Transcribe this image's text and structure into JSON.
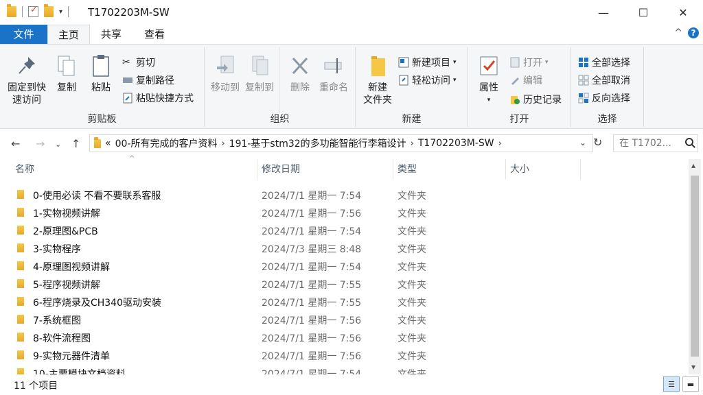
{
  "window": {
    "title": "T1702203M-SW",
    "minimize_glyph": "—",
    "maximize_glyph": "☐",
    "close_glyph": "✕"
  },
  "tabs": {
    "file": "文件",
    "home": "主页",
    "share": "共享",
    "view": "查看"
  },
  "ribbon": {
    "clipboard": {
      "label": "剪贴板",
      "pin": "固定到快速访问",
      "pin_line1": "固定到快",
      "pin_line2": "速访问",
      "copy": "复制",
      "paste": "粘贴",
      "cut": "剪切",
      "copy_path": "复制路径",
      "paste_shortcut": "粘贴快捷方式"
    },
    "organize": {
      "label": "组织",
      "move_to": "移动到",
      "copy_to": "复制到",
      "delete": "删除",
      "rename": "重命名"
    },
    "new": {
      "label": "新建",
      "new_folder_line1": "新建",
      "new_folder_line2": "文件夹",
      "new_item": "新建项目",
      "easy_access": "轻松访问"
    },
    "open": {
      "label": "打开",
      "properties": "属性",
      "open": "打开",
      "edit": "编辑",
      "history": "历史记录"
    },
    "select": {
      "label": "选择",
      "select_all": "全部选择",
      "select_none": "全部取消",
      "invert": "反向选择"
    }
  },
  "address": {
    "prefix": "«",
    "crumbs": [
      "00-所有完成的客户资料",
      "191-基于stm32的多功能智能行李箱设计",
      "T1702203M-SW"
    ],
    "search_placeholder": "在 T1702..."
  },
  "columns": {
    "name": "名称",
    "date": "修改日期",
    "type": "类型",
    "size": "大小"
  },
  "files": [
    {
      "name": "0-使用必读  不看不要联系客服",
      "date": "2024/7/1 星期一 7:54",
      "type": "文件夹"
    },
    {
      "name": "1-实物视频讲解",
      "date": "2024/7/1 星期一 7:56",
      "type": "文件夹"
    },
    {
      "name": "2-原理图&PCB",
      "date": "2024/7/1 星期一 7:54",
      "type": "文件夹"
    },
    {
      "name": "3-实物程序",
      "date": "2024/7/3 星期三 8:48",
      "type": "文件夹"
    },
    {
      "name": "4-原理图视频讲解",
      "date": "2024/7/1 星期一 7:54",
      "type": "文件夹"
    },
    {
      "name": "5-程序视频讲解",
      "date": "2024/7/1 星期一 7:55",
      "type": "文件夹"
    },
    {
      "name": "6-程序烧录及CH340驱动安装",
      "date": "2024/7/1 星期一 7:55",
      "type": "文件夹"
    },
    {
      "name": "7-系统框图",
      "date": "2024/7/1 星期一 7:56",
      "type": "文件夹"
    },
    {
      "name": "8-软件流程图",
      "date": "2024/7/1 星期一 7:56",
      "type": "文件夹"
    },
    {
      "name": "9-实物元器件清单",
      "date": "2024/7/1 星期一 7:56",
      "type": "文件夹"
    },
    {
      "name": "10-主要模块文档资料",
      "date": "2024/7/1 星期一 7:54",
      "type": "文件夹"
    }
  ],
  "status": {
    "item_count": "11 个项目"
  },
  "colors": {
    "accent": "#1a73c8",
    "folder": "#f6c745",
    "ribbon_bg": "#f5f6f7"
  }
}
